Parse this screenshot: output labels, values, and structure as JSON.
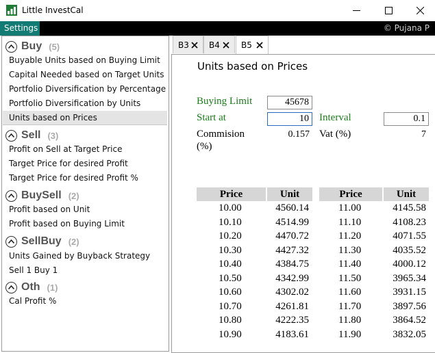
{
  "window": {
    "title": "Little InvestCal"
  },
  "menu": {
    "settings": "Settings",
    "copyright": "© Pujana P"
  },
  "sidebar": {
    "sections": [
      {
        "title": "Buy",
        "count": "(5)",
        "items": [
          "Buyable Units based on Buying Limit",
          "Capital Needed based on Target Units",
          "Portfolio Diversification by Percentage",
          "Portfolio Diversification by Units",
          "Units based on Prices"
        ]
      },
      {
        "title": "Sell",
        "count": "(3)",
        "items": [
          "Profit on Sell at Target Price",
          "Target Price for desired Profit",
          "Target Price for desired Profit %"
        ]
      },
      {
        "title": "BuySell",
        "count": "(2)",
        "items": [
          "Profit based on Unit",
          "Profit based on Buying Limit"
        ]
      },
      {
        "title": "SellBuy",
        "count": "(2)",
        "items": [
          "Units Gained by Buyback Strategy",
          "Sell 1 Buy 1"
        ]
      },
      {
        "title": "Oth",
        "count": "(1)",
        "items": [
          "Cal Profit %"
        ]
      }
    ],
    "selected_item": "Units based on Prices"
  },
  "tabs": [
    {
      "label": "B3",
      "active": false
    },
    {
      "label": "B4",
      "active": false
    },
    {
      "label": "B5",
      "active": true
    }
  ],
  "form": {
    "title": "Units based on Prices",
    "buying_limit_label": "Buying Limit",
    "buying_limit_value": "45678",
    "start_at_label": "Start at",
    "start_at_value": "10",
    "interval_label": "Interval",
    "interval_value": "0.1",
    "commission_label": "Commision",
    "commission_unit": "(%)",
    "commission_value": "0.157",
    "vat_label": "Vat (%)",
    "vat_value": "7"
  },
  "table": {
    "headers": {
      "price": "Price",
      "unit": "Unit"
    },
    "left": [
      [
        "10.00",
        "4560.14"
      ],
      [
        "10.10",
        "4514.99"
      ],
      [
        "10.20",
        "4470.72"
      ],
      [
        "10.30",
        "4427.32"
      ],
      [
        "10.40",
        "4384.75"
      ],
      [
        "10.50",
        "4342.99"
      ],
      [
        "10.60",
        "4302.02"
      ],
      [
        "10.70",
        "4261.81"
      ],
      [
        "10.80",
        "4222.35"
      ],
      [
        "10.90",
        "4183.61"
      ]
    ],
    "right": [
      [
        "11.00",
        "4145.58"
      ],
      [
        "11.10",
        "4108.23"
      ],
      [
        "11.20",
        "4071.55"
      ],
      [
        "11.30",
        "4035.52"
      ],
      [
        "11.40",
        "4000.12"
      ],
      [
        "11.50",
        "3965.34"
      ],
      [
        "11.60",
        "3931.15"
      ],
      [
        "11.70",
        "3897.56"
      ],
      [
        "11.80",
        "3864.52"
      ],
      [
        "11.90",
        "3832.05"
      ]
    ]
  },
  "colors": {
    "menu_accent": "#127b74",
    "label_green": "#1c7b1c",
    "input_focus": "#2a6bbf",
    "table_header": "#d6d6d6"
  }
}
